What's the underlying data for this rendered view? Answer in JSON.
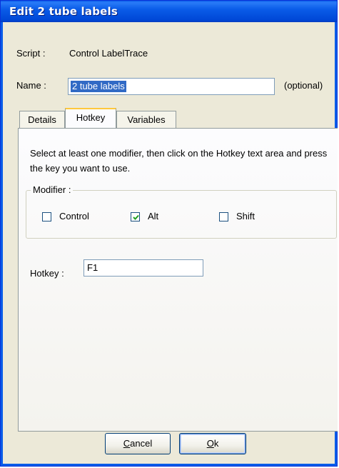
{
  "window": {
    "title": "Edit 2 tube labels"
  },
  "script": {
    "label": "Script :",
    "value": "Control LabelTrace"
  },
  "name": {
    "label": "Name :",
    "value": "2 tube labels",
    "optional_note": "(optional)"
  },
  "tabs": [
    {
      "label": "Details",
      "active": false
    },
    {
      "label": "Hotkey",
      "active": true
    },
    {
      "label": "Variables",
      "active": false
    }
  ],
  "hotkey_tab": {
    "instructions": "Select at least one modifier, then click on the Hotkey text area and press the key you want to use.",
    "modifier_group_label": "Modifier :",
    "modifiers": [
      {
        "label": "Control",
        "checked": false
      },
      {
        "label": "Alt",
        "checked": true
      },
      {
        "label": "Shift",
        "checked": false
      }
    ],
    "hotkey_label": "Hotkey :",
    "hotkey_value": "F1"
  },
  "buttons": {
    "cancel": "Cancel",
    "ok": "Ok"
  },
  "colors": {
    "titlebar": "#0a5ce8",
    "dialog_bg": "#ece9d8",
    "selection": "#316ac5",
    "active_tab_accent": "#ffc83c"
  }
}
